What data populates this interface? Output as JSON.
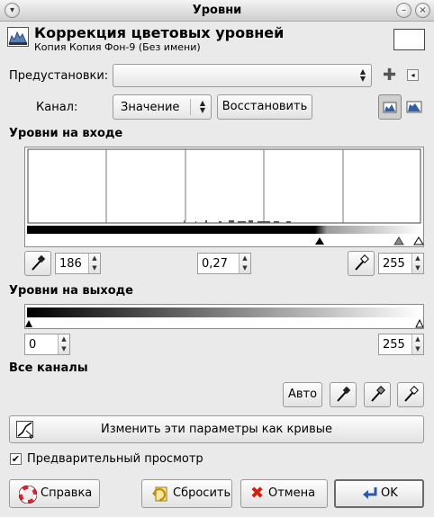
{
  "window": {
    "title": "Уровни"
  },
  "header": {
    "title": "Коррекция цветовых уровней",
    "subtitle": "Копия Копия Фон-9 (Без имени)"
  },
  "presets": {
    "label": "Предустановки:",
    "value": ""
  },
  "channel": {
    "label": "Канал:",
    "value": "Значение",
    "reset_label": "Восстановить"
  },
  "input_levels": {
    "title": "Уровни на входе",
    "low": "186",
    "gamma": "0,27",
    "high": "255"
  },
  "output_levels": {
    "title": "Уровни на выходе",
    "low": "0",
    "high": "255"
  },
  "all_channels": {
    "title": "Все каналы",
    "auto_label": "Авто"
  },
  "curves_button": {
    "label": "Изменить эти параметры как кривые"
  },
  "preview": {
    "label": "Предварительный просмотр",
    "checked": true
  },
  "buttons": {
    "help": "Справка",
    "reset": "Сбросить",
    "cancel": "Отмена",
    "ok": "OK"
  }
}
